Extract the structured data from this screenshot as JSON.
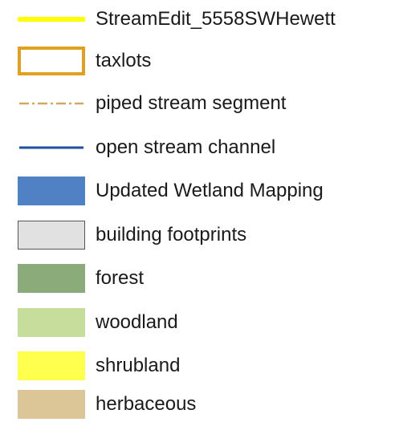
{
  "legend": {
    "items": [
      {
        "label": "StreamEdit_5558SWHewett",
        "symbol": "line",
        "color": "#ffff00",
        "style": "solid"
      },
      {
        "label": "taxlots",
        "symbol": "outline",
        "color": "#e0a020",
        "style": "solid"
      },
      {
        "label": "piped stream segment",
        "symbol": "line",
        "color": "#d4a860",
        "style": "dash-dot"
      },
      {
        "label": "open stream channel",
        "symbol": "line",
        "color": "#1f4fa0",
        "style": "solid"
      },
      {
        "label": "Updated Wetland Mapping",
        "symbol": "fill",
        "color": "#4f81c4",
        "border": "#4f81c4"
      },
      {
        "label": "building footprints",
        "symbol": "fill",
        "color": "#e1e1e1",
        "border": "#555555"
      },
      {
        "label": "forest",
        "symbol": "fill",
        "color": "#8cab7a",
        "border": "#8cab7a"
      },
      {
        "label": "woodland",
        "symbol": "fill",
        "color": "#c7dd9c",
        "border": "#c7dd9c"
      },
      {
        "label": "shrubland",
        "symbol": "fill",
        "color": "#ffff4d",
        "border": "#ffff4d"
      },
      {
        "label": "herbaceous",
        "symbol": "fill",
        "color": "#dcc596",
        "border": "#dcc596"
      }
    ]
  }
}
